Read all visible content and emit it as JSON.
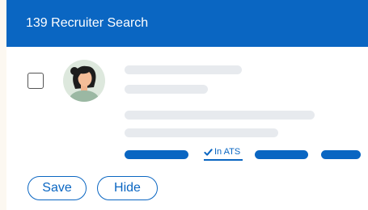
{
  "header": {
    "title": "139 Recruiter Search"
  },
  "candidate": {
    "avatar_icon": "person-avatar-icon",
    "ats_badge": {
      "label": "In ATS",
      "icon": "checkmark-icon"
    }
  },
  "actions": {
    "save_label": "Save",
    "hide_label": "Hide"
  },
  "colors": {
    "primary": "#0a66c2",
    "background": "#fcf8f1",
    "skeleton": "#e7eaee",
    "avatar_bg": "#dde8dd"
  }
}
